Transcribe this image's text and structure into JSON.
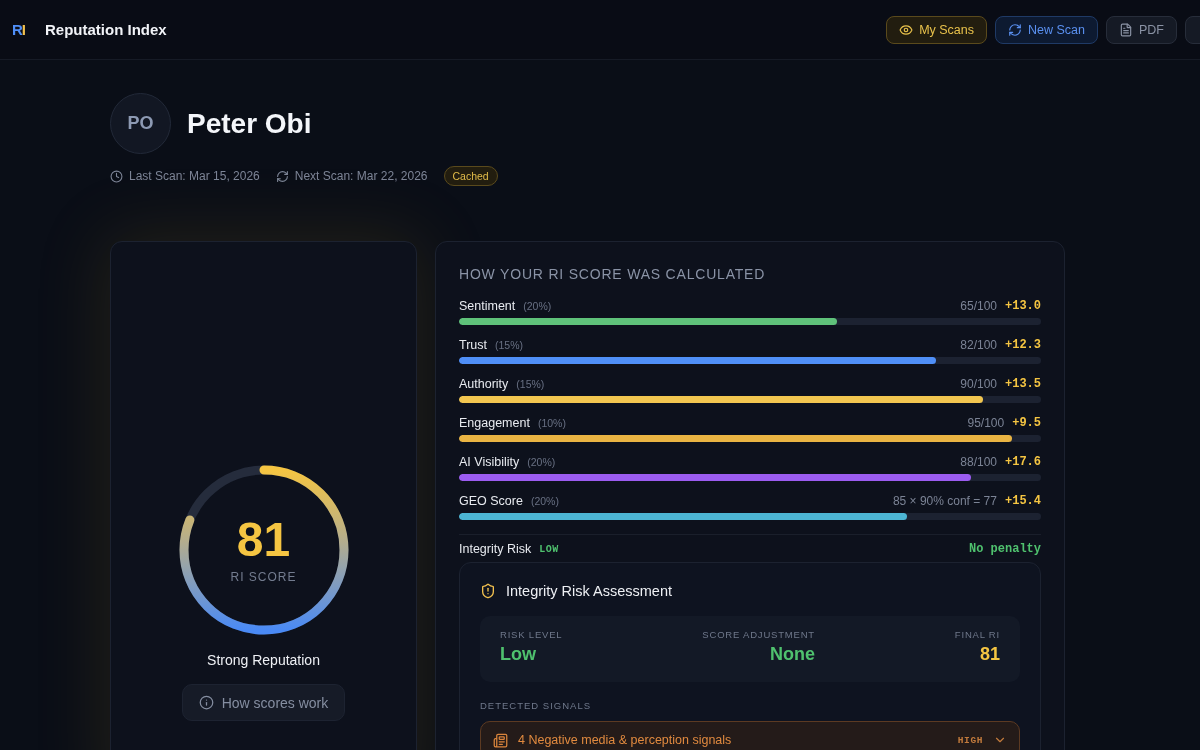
{
  "app": {
    "logo_letters": [
      "R",
      "I"
    ],
    "title": "Reputation Index"
  },
  "toolbar": [
    {
      "kind": "scans",
      "label": "My Scans"
    },
    {
      "kind": "scan",
      "label": "New Scan"
    },
    {
      "kind": "pdf",
      "label": "PDF"
    },
    {
      "kind": "partial"
    }
  ],
  "profile": {
    "initials": "PO",
    "name": "Peter Obi",
    "last_scan": "Last Scan: Mar 15, 2026",
    "next_scan": "Next Scan: Mar 22, 2026",
    "badge": "Cached"
  },
  "score_card": {
    "score": "81",
    "score_label": "RI SCORE",
    "level": 0.81,
    "rating": "Strong Reputation",
    "help_button": "How scores work"
  },
  "breakdown": {
    "title": "HOW YOUR RI SCORE WAS CALCULATED",
    "factors": [
      {
        "name": "Sentiment",
        "weight": "(20%)",
        "reading": "65/100",
        "points": "+13.0",
        "level": 0.65,
        "color": "#5fc27a"
      },
      {
        "name": "Trust",
        "weight": "(15%)",
        "reading": "82/100",
        "points": "+12.3",
        "level": 0.82,
        "color": "#4f8ff7"
      },
      {
        "name": "Authority",
        "weight": "(15%)",
        "reading": "90/100",
        "points": "+13.5",
        "level": 0.9,
        "color": "#f2c650"
      },
      {
        "name": "Engagement",
        "weight": "(10%)",
        "reading": "95/100",
        "points": "+9.5",
        "level": 0.95,
        "color": "#e9b443"
      },
      {
        "name": "AI Visibility",
        "weight": "(20%)",
        "reading": "88/100",
        "points": "+17.6",
        "level": 0.88,
        "color": "#9b5cf0"
      },
      {
        "name": "GEO Score",
        "weight": "(20%)",
        "reading": "85 × 90% conf = 77",
        "points": "+15.4",
        "level": 0.77,
        "color": "#4cb5d3"
      }
    ],
    "integrity": {
      "label": "Integrity Risk",
      "risk": "LOW",
      "penalty": "No penalty"
    }
  },
  "assessment": {
    "title": "Integrity Risk Assessment",
    "stats": [
      {
        "label": "RISK LEVEL",
        "value": "Low",
        "color": "#4fc16e"
      },
      {
        "label": "SCORE ADJUSTMENT",
        "value": "None",
        "color": "#4fc16e"
      },
      {
        "label": "FINAL RI",
        "value": "81",
        "color": "#f5c542"
      }
    ],
    "signals_title": "DETECTED SIGNALS",
    "signals": [
      {
        "text": "4 Negative media & perception signals",
        "severity": "HIGH",
        "expanded": false
      }
    ]
  }
}
